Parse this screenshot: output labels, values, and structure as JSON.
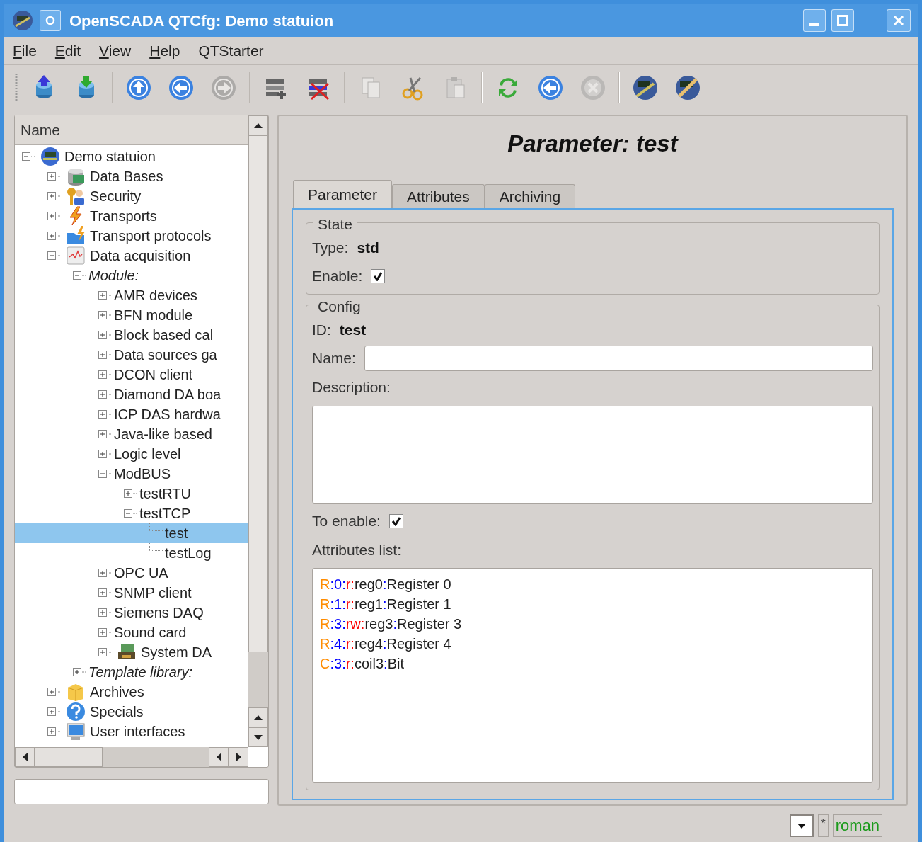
{
  "window": {
    "title": "OpenSCADA QTCfg: Demo statuion"
  },
  "menu": [
    {
      "label": "File",
      "mnemonic": true
    },
    {
      "label": "Edit",
      "mnemonic": true
    },
    {
      "label": "View",
      "mnemonic": true
    },
    {
      "label": "Help",
      "mnemonic": true
    },
    {
      "label": "QTStarter",
      "mnemonic": false
    }
  ],
  "toolbar": [
    [
      {
        "kind": "db-up",
        "disabled": false
      },
      {
        "kind": "db-down",
        "disabled": false
      }
    ],
    [
      {
        "kind": "up",
        "disabled": false
      },
      {
        "kind": "back",
        "disabled": false
      },
      {
        "kind": "forward",
        "disabled": true
      }
    ],
    [
      {
        "kind": "add",
        "disabled": false
      },
      {
        "kind": "delete",
        "disabled": false
      }
    ],
    [
      {
        "kind": "copy",
        "disabled": true
      },
      {
        "kind": "cut",
        "disabled": false
      },
      {
        "kind": "paste",
        "disabled": true
      }
    ],
    [
      {
        "kind": "refresh",
        "disabled": false
      },
      {
        "kind": "start",
        "disabled": false
      },
      {
        "kind": "stop",
        "disabled": true
      }
    ],
    [
      {
        "kind": "station",
        "disabled": false
      },
      {
        "kind": "station-edit",
        "disabled": false
      }
    ]
  ],
  "tree": {
    "header": "Name",
    "items": [
      {
        "label": "Demo statuion",
        "kind": "station",
        "expanded": true,
        "selected": false,
        "children": [
          {
            "label": "Data Bases",
            "kind": "db",
            "expanded": false,
            "selected": false
          },
          {
            "label": "Security",
            "kind": "security",
            "expanded": false,
            "selected": false
          },
          {
            "label": "Transports",
            "kind": "transport",
            "expanded": false,
            "selected": false
          },
          {
            "label": "Transport protocols",
            "kind": "protocols",
            "expanded": false,
            "selected": false
          },
          {
            "label": "Data acquisition",
            "kind": "daq",
            "expanded": true,
            "selected": false,
            "children": [
              {
                "label": "Module:",
                "kind": "group",
                "expanded": true,
                "selected": false,
                "children": [
                  {
                    "label": "AMR devices",
                    "kind": "plain",
                    "expanded": false,
                    "selected": false
                  },
                  {
                    "label": "BFN module",
                    "kind": "plain",
                    "expanded": false,
                    "selected": false
                  },
                  {
                    "label": "Block based cal",
                    "kind": "plain",
                    "expanded": false,
                    "selected": false
                  },
                  {
                    "label": "Data sources ga",
                    "kind": "plain",
                    "expanded": false,
                    "selected": false
                  },
                  {
                    "label": "DCON client",
                    "kind": "plain",
                    "expanded": false,
                    "selected": false
                  },
                  {
                    "label": "Diamond DA boa",
                    "kind": "plain",
                    "expanded": false,
                    "selected": false
                  },
                  {
                    "label": "ICP DAS hardwa",
                    "kind": "plain",
                    "expanded": false,
                    "selected": false
                  },
                  {
                    "label": "Java-like based",
                    "kind": "plain",
                    "expanded": false,
                    "selected": false
                  },
                  {
                    "label": "Logic level",
                    "kind": "plain",
                    "expanded": false,
                    "selected": false
                  },
                  {
                    "label": "ModBUS",
                    "kind": "plain",
                    "expanded": true,
                    "selected": false,
                    "children": [
                      {
                        "label": "testRTU",
                        "expanded": false,
                        "selected": false
                      },
                      {
                        "label": "testTCP",
                        "expanded": true,
                        "selected": false,
                        "children": [
                          {
                            "label": "test",
                            "selected": true
                          },
                          {
                            "label": "testLog",
                            "selected": false
                          }
                        ]
                      }
                    ]
                  },
                  {
                    "label": "OPC UA",
                    "kind": "plain",
                    "expanded": false,
                    "selected": false
                  },
                  {
                    "label": "SNMP client",
                    "kind": "plain",
                    "expanded": false,
                    "selected": false
                  },
                  {
                    "label": "Siemens DAQ",
                    "kind": "plain",
                    "expanded": false,
                    "selected": false
                  },
                  {
                    "label": "Sound card",
                    "kind": "plain",
                    "expanded": false,
                    "selected": false
                  },
                  {
                    "label": "System DA",
                    "kind": "system",
                    "expanded": false,
                    "selected": false
                  }
                ]
              },
              {
                "label": "Template library:",
                "kind": "group",
                "expanded": false,
                "selected": false
              }
            ]
          },
          {
            "label": "Archives",
            "kind": "archive",
            "expanded": false,
            "selected": false
          },
          {
            "label": "Specials",
            "kind": "specials",
            "expanded": false,
            "selected": false
          },
          {
            "label": "User interfaces",
            "kind": "ui",
            "expanded": false,
            "selected": false
          }
        ]
      }
    ]
  },
  "page": {
    "title": "Parameter: test",
    "tabs": [
      {
        "label": "Parameter",
        "selected": true
      },
      {
        "label": "Attributes",
        "selected": false
      },
      {
        "label": "Archiving",
        "selected": false
      }
    ],
    "state": {
      "title": "State",
      "type_label": "Type:",
      "type_value": "std",
      "enable_label": "Enable:",
      "enable_checked": true
    },
    "config": {
      "title": "Config",
      "id_label": "ID:",
      "id_value": "test",
      "name_label": "Name:",
      "description_label": "Description:",
      "to_enable_label": "To enable:",
      "to_enable_checked": true,
      "attributes_label": "Attributes list:",
      "attributes": [
        {
          "segments": [
            {
              "text": "R",
              "color": "#ff8c00"
            },
            {
              "text": ":0:",
              "color": "#0000ff"
            },
            {
              "text": "r:",
              "color": "#ff0000"
            },
            {
              "text": "reg0",
              "color": "#202020"
            },
            {
              "text": ":",
              "color": "#0000ff"
            },
            {
              "text": "Register 0",
              "color": "#202020"
            }
          ]
        },
        {
          "segments": [
            {
              "text": "R",
              "color": "#ff8c00"
            },
            {
              "text": ":1:",
              "color": "#0000ff"
            },
            {
              "text": "r:",
              "color": "#ff0000"
            },
            {
              "text": "reg1",
              "color": "#202020"
            },
            {
              "text": ":",
              "color": "#0000ff"
            },
            {
              "text": "Register 1",
              "color": "#202020"
            }
          ]
        },
        {
          "segments": [
            {
              "text": "R",
              "color": "#ff8c00"
            },
            {
              "text": ":3:",
              "color": "#0000ff"
            },
            {
              "text": "rw:",
              "color": "#ff0000"
            },
            {
              "text": "reg3",
              "color": "#202020"
            },
            {
              "text": ":",
              "color": "#0000ff"
            },
            {
              "text": "Register 3",
              "color": "#202020"
            }
          ]
        },
        {
          "segments": [
            {
              "text": "R",
              "color": "#ff8c00"
            },
            {
              "text": ":4:",
              "color": "#0000ff"
            },
            {
              "text": "r:",
              "color": "#ff0000"
            },
            {
              "text": "reg4",
              "color": "#202020"
            },
            {
              "text": ":",
              "color": "#0000ff"
            },
            {
              "text": "Register 4",
              "color": "#202020"
            }
          ]
        },
        {
          "segments": [
            {
              "text": "C",
              "color": "#ff8c00"
            },
            {
              "text": ":3:",
              "color": "#0000ff"
            },
            {
              "text": "r:",
              "color": "#ff0000"
            },
            {
              "text": "coil3",
              "color": "#202020"
            },
            {
              "text": ":",
              "color": "#0000ff"
            },
            {
              "text": "Bit",
              "color": "#202020"
            }
          ]
        }
      ]
    }
  },
  "status_bar": {
    "flag": "*",
    "user": "roman"
  }
}
